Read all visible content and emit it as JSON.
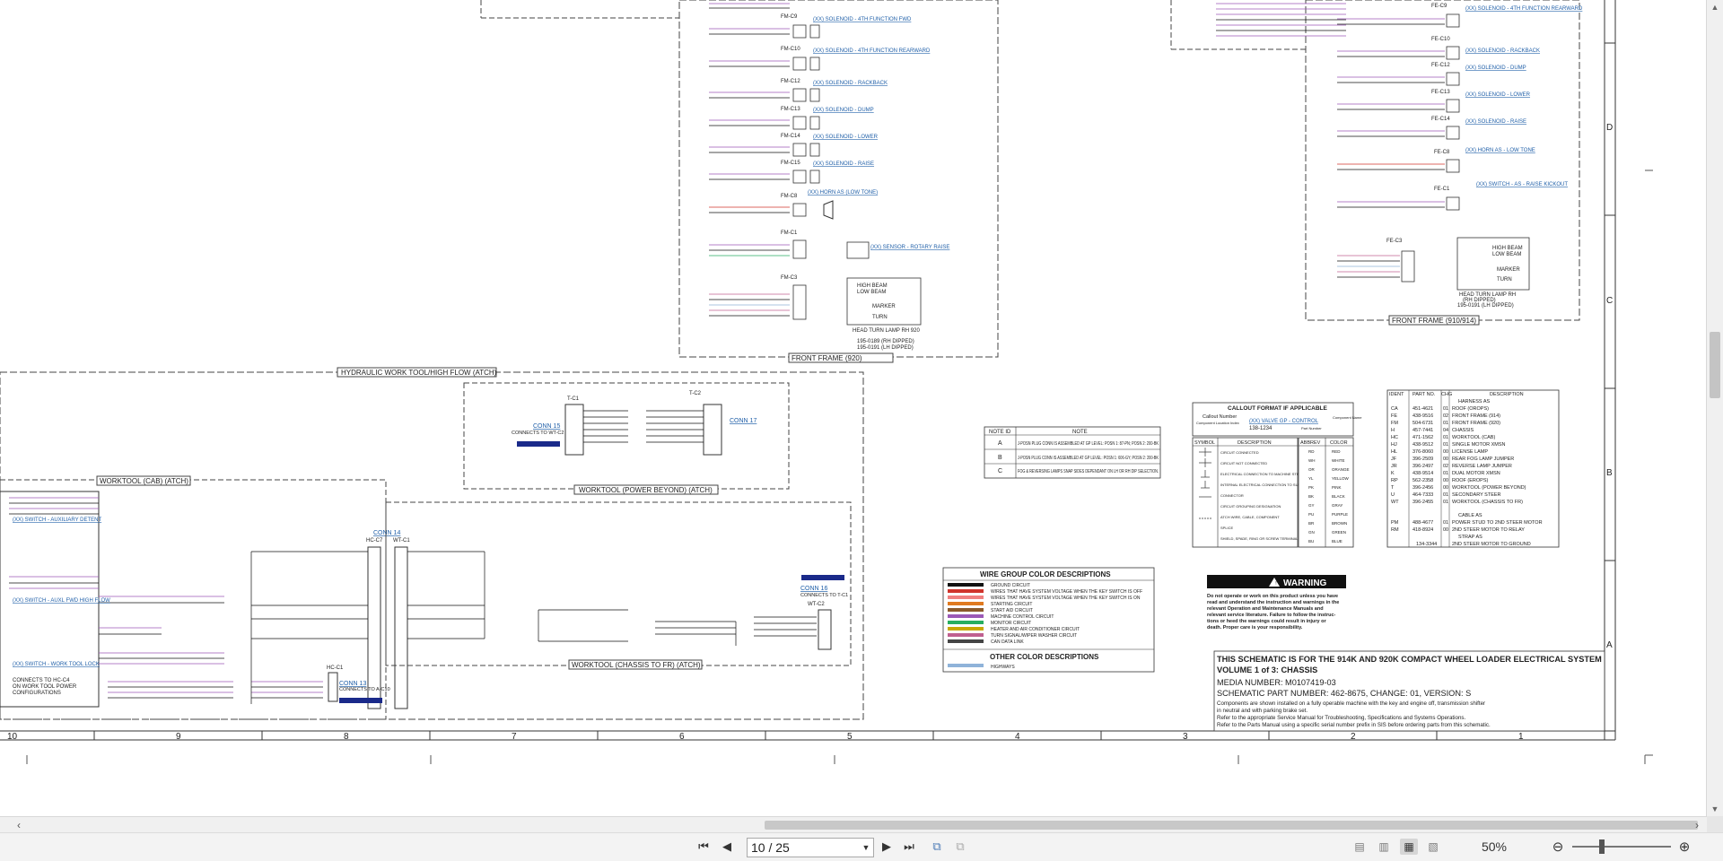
{
  "document": {
    "title_block": {
      "line1": "THIS SCHEMATIC IS FOR THE 914K AND 920K COMPACT WHEEL LOADER ELECTRICAL SYSTEM",
      "line2": "VOLUME 1 of 3: CHASSIS",
      "line3": "MEDIA NUMBER: M0107419-03",
      "line4": "SCHEMATIC PART NUMBER: 462-8675, CHANGE: 01, VERSION: S",
      "notes": [
        "Components are shown installed on a fully operable machine with the key and engine off, transmission shifter",
        "in neutral and with parking brake set.",
        "Refer to the appropriate Service Manual for Troubleshooting, Specifications and Systems Operations.",
        "Refer to the Parts Manual using a specific serial number prefix in SIS before ordering parts from this schematic."
      ]
    },
    "column_numbers": [
      "10",
      "9",
      "8",
      "7",
      "6",
      "5",
      "4",
      "3",
      "2",
      "1"
    ],
    "row_letters": [
      "D",
      "C",
      "B",
      "A"
    ],
    "section_labels": {
      "front_frame_920": "FRONT FRAME (920)",
      "front_frame_910_914": "FRONT FRAME (910/914)",
      "hydraulic_worktool": "HYDRAULIC WORK TOOL/HIGH FLOW (ATCH)",
      "worktool_cab": "WORKTOOL (CAB) (ATCH)",
      "worktool_power_beyond": "WORKTOOL (POWER BEYOND) (ATCH)",
      "worktool_chassis": "WORKTOOL (CHASSIS TO FR) (ATCH)"
    },
    "connectors": {
      "conn15": "CONN 15",
      "conn15_desc": "CONNECTS TO WT-C2",
      "conn17": "CONN 17",
      "conn14": "CONN 14",
      "conn16": "CONN 16",
      "conn16_desc": "CONNECTS TO T-C1",
      "conn13": "CONN 13",
      "conn13_desc": "CONNECTS TO A-C10",
      "hc_c7": "HC-C7",
      "wt_c1": "WT-C1",
      "hc_c1": "HC-C1",
      "t_c1": "T-C1",
      "t_c2": "T-C2",
      "wt_c2": "WT-C2"
    },
    "components_920": [
      {
        "id": "FM-C9",
        "label": "(XX) SOLENOID - 4TH FUNCTION FWD"
      },
      {
        "id": "FM-C10",
        "label": "(XX) SOLENOID - 4TH FUNCTION REARWARD"
      },
      {
        "id": "FM-C12",
        "label": "(XX) SOLENOID - RACKBACK"
      },
      {
        "id": "FM-C13",
        "label": "(XX) SOLENOID - DUMP"
      },
      {
        "id": "FM-C14",
        "label": "(XX) SOLENOID - LOWER"
      },
      {
        "id": "FM-C15",
        "label": "(XX) SOLENOID - RAISE"
      },
      {
        "id": "FM-C8",
        "label": "(XX) HORN AS (LOW TONE)"
      },
      {
        "id": "FM-C1",
        "label": "(XX) SENSOR - ROTARY RAISE"
      },
      {
        "id": "FM-C3",
        "label": "HEAD TURN LAMP RH 920"
      }
    ],
    "components_914": [
      {
        "id": "FE-C9",
        "label": "(XX) SOLENOID - 4TH FUNCTION REARWARD"
      },
      {
        "id": "FE-C10",
        "label": "(XX) SOLENOID - RACKBACK"
      },
      {
        "id": "FE-C12",
        "label": "(XX) SOLENOID - DUMP"
      },
      {
        "id": "FE-C13",
        "label": "(XX) SOLENOID - LOWER"
      },
      {
        "id": "FE-C14",
        "label": "(XX) SOLENOID - RAISE"
      },
      {
        "id": "FE-C8",
        "label": "(XX) HORN AS - LOW TONE"
      },
      {
        "id": "FE-C1",
        "label": "(XX) SWITCH - AS - RAISE KICKOUT"
      },
      {
        "id": "FE-C3",
        "label": "HEAD TURN LAMP RH"
      }
    ],
    "lamp_labels": [
      "HIGH BEAM",
      "LOW BEAM",
      "MARKER",
      "TURN"
    ],
    "lamp_parts_920": [
      "195-0189 (RH DIPPED)",
      "195-0191 (LH DIPPED)"
    ],
    "lamp_parts_914": [
      "(RH DIPPED)",
      "195-0191 (LH DIPPED)"
    ],
    "notes_table": {
      "headers": [
        "NOTE ID",
        "NOTE"
      ],
      "rows": [
        {
          "id": "A",
          "text": "J-POSN PLUG CONN IS ASSEMBLED AT GP LEVEL: POSN 1: 87-PN; POSN 2: 200-BK"
        },
        {
          "id": "B",
          "text": "J-POSN PLUG CONN IS ASSEMBLED AT GP LEVEL: POSN 1: 606-GY; POSN 2: 200-BK"
        },
        {
          "id": "C",
          "text": "FOG & REVERSING LAMPS SNAP SIDES DEPENDANT ON LH OR RH DIP SELECTION."
        }
      ]
    },
    "callout": {
      "title": "CALLOUT FORMAT IF APPLICABLE",
      "left1": "Callout Number",
      "left2": "Component Location Index",
      "example": "(XX) VALVE GP - CONTROL",
      "part": "138-1234",
      "right1": "Component Name",
      "right2": "Part Number"
    },
    "symbols": {
      "headers": [
        "SYMBOL",
        "DESCRIPTION"
      ],
      "rows": [
        "CIRCUIT CONNECTED",
        "CIRCUIT NOT CONNECTED",
        "ELECTRICAL CONNECTION TO MACHINE STRUCTURE",
        "INTERNAL ELECTRICAL CONNECTION TO SURFACE OF COMPONENT",
        "CONNECTOR",
        "CIRCUIT GROUPING DESIGNATION",
        "ATCH WIRE, CABLE, COMPONENT",
        "SPLICE",
        "SHIELD, SPADE, RING OR SCREW TERMINAL"
      ]
    },
    "colors_table": {
      "headers": [
        "ABBREV",
        "COLOR"
      ],
      "rows": [
        [
          "RD",
          "RED"
        ],
        [
          "WH",
          "WHITE"
        ],
        [
          "OR",
          "ORANGE"
        ],
        [
          "YL",
          "YELLOW"
        ],
        [
          "PK",
          "PINK"
        ],
        [
          "BK",
          "BLACK"
        ],
        [
          "GY",
          "GRAY"
        ],
        [
          "PU",
          "PURPLE"
        ],
        [
          "BR",
          "BROWN"
        ],
        [
          "GN",
          "GREEN"
        ],
        [
          "BU",
          "BLUE"
        ]
      ]
    },
    "harness_table": {
      "headers": [
        "IDENT",
        "PART NO.",
        "CHG",
        "DESCRIPTION"
      ],
      "subheader1": "HARNESS AS",
      "rows": [
        [
          "CA",
          "451-4621",
          "01",
          "ROOF (OROPS)"
        ],
        [
          "FE",
          "438-9516",
          "02",
          "FRONT FRAME (914)"
        ],
        [
          "FM",
          "504-6731",
          "01",
          "FRONT FRAME (920)"
        ],
        [
          "H",
          "457-7441",
          "04",
          "CHASSIS"
        ],
        [
          "HC",
          "471-1562",
          "01",
          "WORKTOOL (CAB)"
        ],
        [
          "HJ",
          "438-9512",
          "01",
          "SINGLE MOTOR XMSN"
        ],
        [
          "HL",
          "376-8060",
          "00",
          "LICENSE LAMP"
        ],
        [
          "JF",
          "396-2509",
          "00",
          "REAR FOG LAMP JUMPER"
        ],
        [
          "JR",
          "396-2497",
          "02",
          "REVERSE LAMP JUMPER"
        ],
        [
          "K",
          "438-9514",
          "01",
          "DUAL MOTOR XMSN"
        ],
        [
          "RP",
          "562-2358",
          "00",
          "ROOF (EROPS)"
        ],
        [
          "T",
          "396-2456",
          "00",
          "WORKTOOL (POWER BEYOND)"
        ],
        [
          "U",
          "464-7333",
          "01",
          "SECONDARY STEER"
        ],
        [
          "WT",
          "396-2455",
          "01",
          "WORKTOOL (CHASSIS TO FR)"
        ]
      ],
      "subheader2": "CABLE AS",
      "rows2": [
        [
          "PM",
          "488-4677",
          "01",
          "POWER STUD TO 2ND STEER MOTOR"
        ],
        [
          "RM",
          "418-8924",
          "00",
          "2ND STEER MOTOR TO RELAY"
        ]
      ],
      "subheader3": "STRAP AS",
      "rows3": [
        [
          "",
          "134-3344",
          "",
          "2ND STEER MOTOR TO GROUND"
        ]
      ]
    },
    "wire_colors": {
      "title": "WIRE GROUP COLOR DESCRIPTIONS",
      "rows": [
        {
          "color": "#111111",
          "label": "GROUND CIRCUIT"
        },
        {
          "color": "#d0342c",
          "label": "WIRES THAT HAVE SYSTEM VOLTAGE WHEN THE KEY SWITCH IS OFF"
        },
        {
          "color": "#f08080",
          "label": "WIRES THAT HAVE SYSTEM VOLTAGE WHEN THE KEY SWITCH IS ON"
        },
        {
          "color": "#e07a20",
          "label": "STARTING CIRCUIT"
        },
        {
          "color": "#8b5a2b",
          "label": "START AID CIRCUIT"
        },
        {
          "color": "#9b59b6",
          "label": "MACHINE CONTROL CIRCUIT"
        },
        {
          "color": "#27ae60",
          "label": "MONITOR CIRCUIT"
        },
        {
          "color": "#c8a800",
          "label": "HEATER AND AIR CONDITIONER CIRCUIT"
        },
        {
          "color": "#c06090",
          "label": "TURN SIGNAL/WIPER WASHER CIRCUIT"
        },
        {
          "color": "#444444",
          "label": "CAN DATA LINK"
        }
      ],
      "other_title": "OTHER COLOR DESCRIPTIONS",
      "other_rows": [
        {
          "color": "#8fb3d9",
          "label": "HIGHWAYS"
        }
      ]
    },
    "warning": {
      "title": "WARNING",
      "text": [
        "Do not operate or work on this product unless you have",
        "read and understand the instruction and warnings in the",
        "relevant Operation and Maintenance Manuals and",
        "relevant service literature. Failure to follow the instruc-",
        "tions or heed the warnings could result in injury or",
        "death. Proper care is your responsibility."
      ]
    },
    "left_switches": [
      "(XX) SWITCH - AUXILIARY DETENT",
      "(XX) SWITCH - AUXL FWD HIGH FLOW",
      "(XX) SWITCH - WORK TOOL LOCK"
    ],
    "left_notes": [
      "CONNECTS TO HC-C4",
      "ON WORK TOOL POWER",
      "CONFIGURATIONS"
    ]
  },
  "toolbar": {
    "page_value": "10 / 25",
    "zoom": "50%",
    "first_icon": "first-page-icon",
    "prev_icon": "prev-page-icon",
    "next_icon": "next-page-icon",
    "last_icon": "last-page-icon"
  }
}
